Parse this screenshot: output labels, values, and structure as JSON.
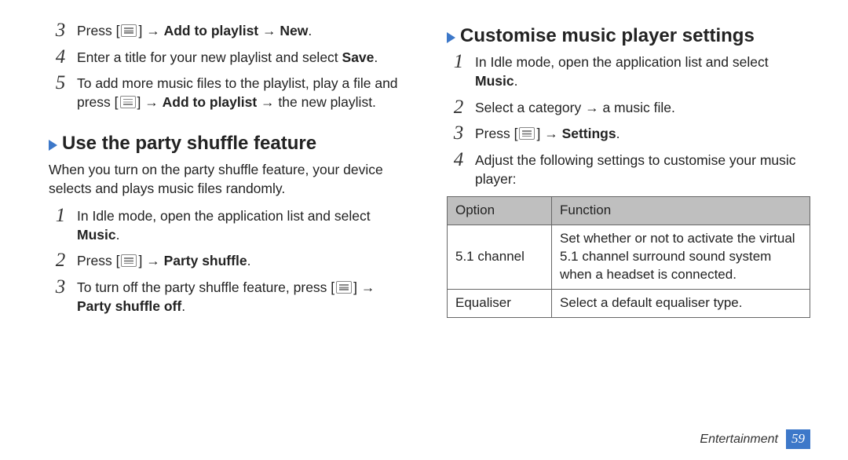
{
  "left": {
    "steps_top": [
      {
        "num": "3",
        "parts": [
          "Press [",
          "MENU",
          "] → ",
          "**Add to playlist**",
          " → ",
          "**New**",
          "."
        ]
      },
      {
        "num": "4",
        "parts": [
          "Enter a title for your new playlist and select ",
          "**Save**",
          "."
        ]
      },
      {
        "num": "5",
        "parts": [
          "To add more music files to the playlist, play a file and press [",
          "MENU",
          "] → ",
          "**Add to playlist**",
          " → the new playlist."
        ]
      }
    ],
    "h2": "Use the party shuffle feature",
    "intro": "When you turn on the party shuffle feature, your device selects and plays music files randomly.",
    "steps_bottom": [
      {
        "num": "1",
        "parts": [
          "In Idle mode, open the application list and select ",
          "**Music**",
          "."
        ]
      },
      {
        "num": "2",
        "parts": [
          "Press [",
          "MENU",
          "] → ",
          "**Party shuffle**",
          "."
        ]
      },
      {
        "num": "3",
        "parts": [
          "To turn off the party shuffle feature, press [",
          "MENU",
          "] → ",
          "**Party shuffle off**",
          "."
        ]
      }
    ]
  },
  "right": {
    "h2": "Customise music player settings",
    "steps": [
      {
        "num": "1",
        "parts": [
          "In Idle mode, open the application list and select ",
          "**Music**",
          "."
        ]
      },
      {
        "num": "2",
        "parts": [
          "Select a category → a music file."
        ]
      },
      {
        "num": "3",
        "parts": [
          "Press [",
          "MENU",
          "] → ",
          "**Settings**",
          "."
        ]
      },
      {
        "num": "4",
        "parts": [
          "Adjust the following settings to customise your music player:"
        ]
      }
    ],
    "table": {
      "headers": [
        "Option",
        "Function"
      ],
      "rows": [
        [
          "5.1 channel",
          "Set whether or not to activate the virtual 5.1 channel surround sound system when a headset is connected."
        ],
        [
          "Equaliser",
          "Select a default equaliser type."
        ]
      ]
    }
  },
  "footer": {
    "section": "Entertainment",
    "page": "59"
  }
}
